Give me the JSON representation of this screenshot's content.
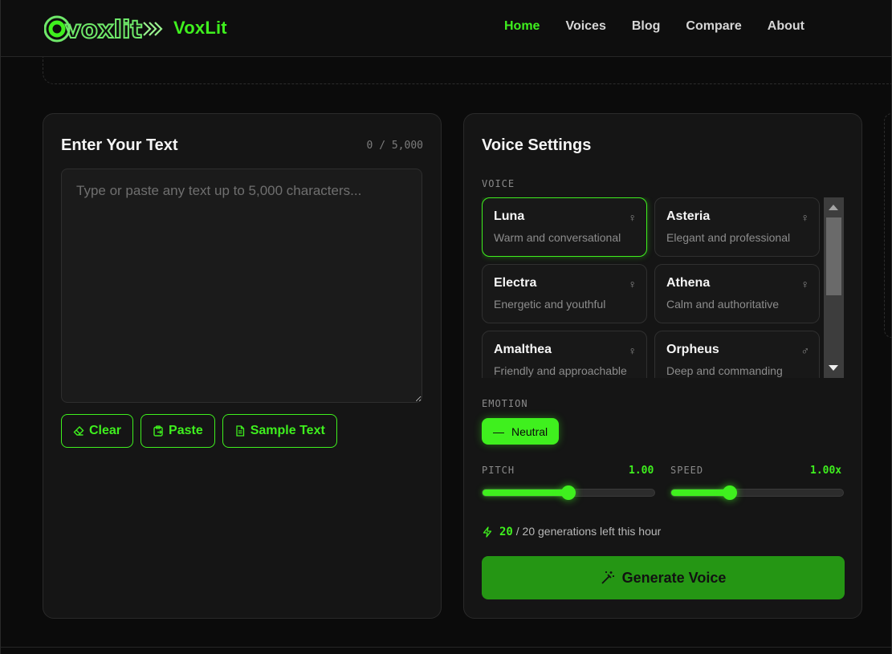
{
  "colors": {
    "accent": "#3ff01e",
    "bg": "#0b0b0b",
    "panel": "#151515",
    "generate_btn": "#259614"
  },
  "header": {
    "logo_text": "voxlit",
    "brand": "VoxLit",
    "nav": [
      {
        "label": "Home",
        "active": true
      },
      {
        "label": "Voices",
        "active": false
      },
      {
        "label": "Blog",
        "active": false
      },
      {
        "label": "Compare",
        "active": false
      },
      {
        "label": "About",
        "active": false
      }
    ]
  },
  "editor": {
    "title": "Enter Your Text",
    "counter": "0 / 5,000",
    "placeholder": "Type or paste any text up to 5,000 characters...",
    "value": "",
    "buttons": {
      "clear": "Clear",
      "paste": "Paste",
      "sample": "Sample Text"
    }
  },
  "settings": {
    "title": "Voice Settings",
    "voice_label": "VOICE",
    "voices": [
      {
        "name": "Luna",
        "desc": "Warm and conversational",
        "gender": "female",
        "selected": true
      },
      {
        "name": "Asteria",
        "desc": "Elegant and professional",
        "gender": "female",
        "selected": false
      },
      {
        "name": "Electra",
        "desc": "Energetic and youthful",
        "gender": "female",
        "selected": false
      },
      {
        "name": "Athena",
        "desc": "Calm and authoritative",
        "gender": "female",
        "selected": false
      },
      {
        "name": "Amalthea",
        "desc": "Friendly and approachable",
        "gender": "female",
        "selected": false
      },
      {
        "name": "Orpheus",
        "desc": "Deep and commanding",
        "gender": "male",
        "selected": false
      }
    ],
    "emotion_label": "EMOTION",
    "emotion": "Neutral",
    "pitch_label": "PITCH",
    "pitch_value": "1.00",
    "pitch_fraction": 0.5,
    "speed_label": "SPEED",
    "speed_value": "1.00x",
    "speed_fraction": 0.34,
    "gens_left": "20",
    "gens_text": "/ 20 generations left this hour",
    "generate_label": "Generate Voice"
  }
}
